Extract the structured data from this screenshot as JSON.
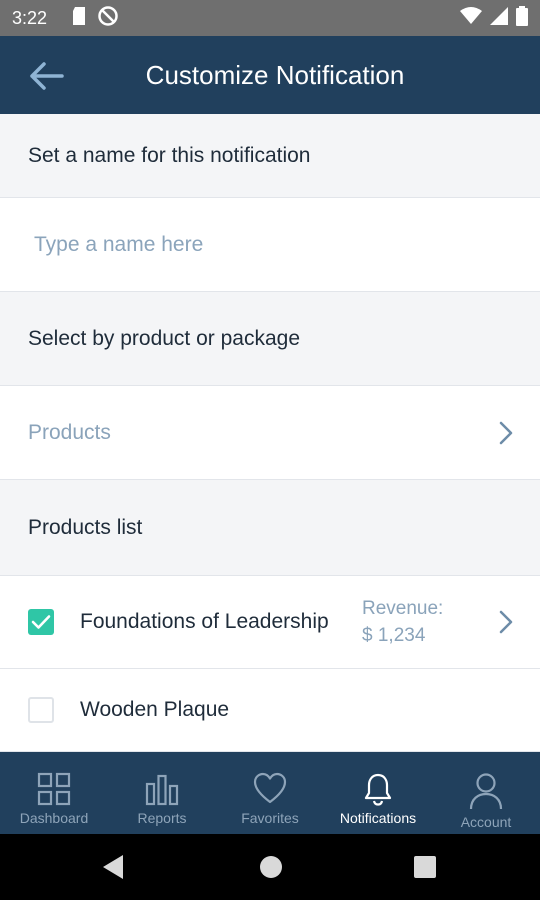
{
  "status_bar": {
    "time": "3:22",
    "left_icons": [
      "sd-card-icon",
      "no-sync-icon"
    ],
    "right_icons": [
      "wifi-icon",
      "signal-icon",
      "battery-icon"
    ]
  },
  "app_bar": {
    "title": "Customize Notification",
    "back_icon": "arrow-left-icon"
  },
  "name_section": {
    "header": "Set a name for this notification",
    "input_placeholder": "Type a name here",
    "input_value": ""
  },
  "select_section": {
    "header": "Select by product or package",
    "link_label": "Products"
  },
  "products_list": {
    "header": "Products list",
    "items": [
      {
        "name": "Foundations of Leadership",
        "checked": true,
        "revenue_label": "Revenue:",
        "revenue_value": "$ 1,234"
      },
      {
        "name": "Wooden Plaque",
        "checked": false
      }
    ]
  },
  "bottom_nav": {
    "items": [
      {
        "label": "Dashboard",
        "icon": "grid-icon",
        "active": false
      },
      {
        "label": "Reports",
        "icon": "bar-chart-icon",
        "active": false
      },
      {
        "label": "Favorites",
        "icon": "heart-icon",
        "active": false
      },
      {
        "label": "Notifications",
        "icon": "bell-icon",
        "active": true
      },
      {
        "label": "Account",
        "icon": "person-icon",
        "active": false
      }
    ]
  },
  "system_nav": [
    "back-triangle-icon",
    "home-circle-icon",
    "recents-square-icon"
  ],
  "colors": {
    "primary_navy": "#21405d",
    "accent_teal": "#2fc6a6",
    "muted_blue": "#8aa3ba",
    "background": "#f4f5f7"
  }
}
